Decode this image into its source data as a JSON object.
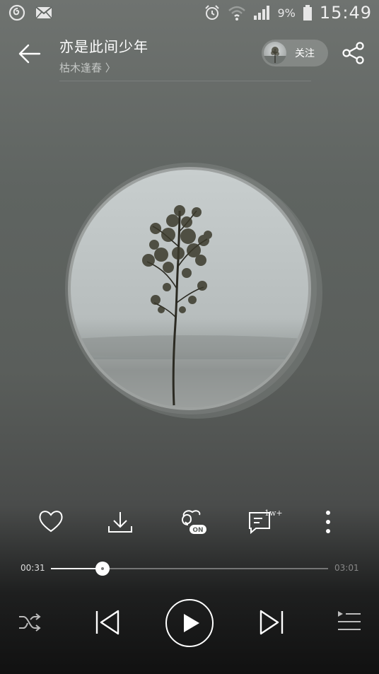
{
  "status_bar": {
    "left_icons": [
      "netease-music-icon",
      "mail-icon"
    ],
    "right_icons": [
      "alarm-icon",
      "wifi-icon",
      "signal-icon",
      "battery-icon"
    ],
    "battery_percent": "9%",
    "time": "15:49"
  },
  "header": {
    "song_title": "亦是此间少年",
    "artist": "枯木逢春 〉",
    "follow_label": "关注"
  },
  "actions": {
    "comment_badge": "1w+"
  },
  "player": {
    "current_time": "00:31",
    "total_time": "03:01",
    "progress_fraction": 0.185
  },
  "colors": {
    "background_top": "#6f7370",
    "background_bottom": "#111111",
    "accent": "#ffffff"
  }
}
